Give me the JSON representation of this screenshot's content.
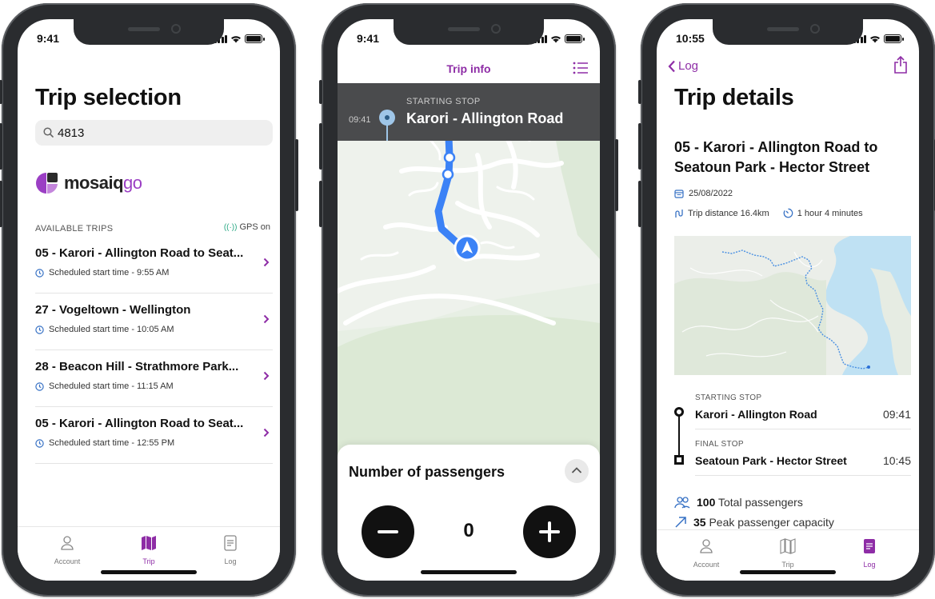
{
  "colors": {
    "accent": "#8e2da6",
    "route": "#3b82f6",
    "gps": "#2aa884"
  },
  "screen1": {
    "status_time": "9:41",
    "title": "Trip selection",
    "search_value": "4813",
    "logo_prefix": "mosaiq",
    "logo_suffix": "go",
    "available_label": "AVAILABLE TRIPS",
    "gps_label": "GPS on",
    "trips": [
      {
        "name": "05 - Karori - Allington Road to Seat...",
        "schedule": "Scheduled start time - 9:55 AM"
      },
      {
        "name": "27 - Vogeltown - Wellington",
        "schedule": "Scheduled start time - 10:05 AM"
      },
      {
        "name": "28 - Beacon Hill - Strathmore Park...",
        "schedule": "Scheduled start time - 11:15 AM"
      },
      {
        "name": "05 - Karori - Allington Road to Seat...",
        "schedule": "Scheduled start time - 12:55 PM"
      }
    ],
    "tabs": [
      "Account",
      "Trip",
      "Log"
    ]
  },
  "screen2": {
    "status_time": "9:41",
    "header_title": "Trip info",
    "stop_time": "09:41",
    "stop_label": "STARTING STOP",
    "stop_name": "Karori - Allington Road",
    "passengers_title": "Number of passengers",
    "passenger_count": "0"
  },
  "screen3": {
    "status_time": "10:55",
    "back_label": "Log",
    "title": "Trip details",
    "route_name": "05 - Karori - Allington Road to Seatoun Park - Hector Street",
    "date": "25/08/2022",
    "distance": "Trip distance 16.4km",
    "duration": "1 hour 4 minutes",
    "starting_label": "STARTING STOP",
    "starting_name": "Karori - Allington Road",
    "starting_time": "09:41",
    "final_label": "FINAL STOP",
    "final_name": "Seatoun Park - Hector Street",
    "final_time": "10:45",
    "total_passengers_value": "100",
    "total_passengers_label": "Total passengers",
    "peak_value": "35",
    "peak_label": "Peak passenger capacity",
    "tabs": [
      "Account",
      "Trip",
      "Log"
    ]
  }
}
